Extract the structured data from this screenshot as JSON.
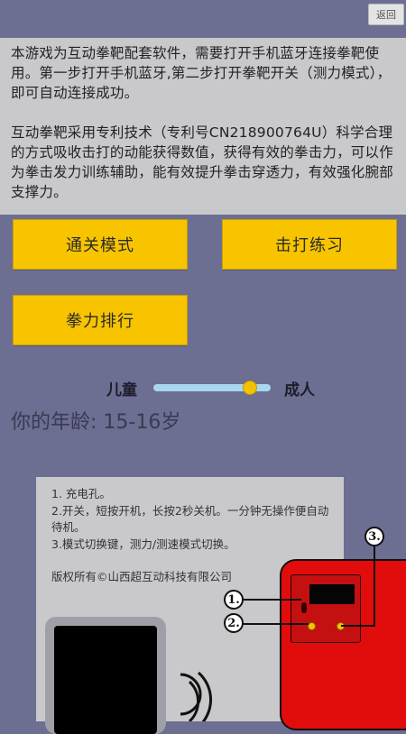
{
  "header": {
    "back_label": "返回"
  },
  "intro": {
    "paragraph1": "本游戏为互动拳靶配套软件，需要打开手机蓝牙连接拳靶使用。第一步打开手机蓝牙,第二步打开拳靶开关（测力模式），即可自动连接成功。",
    "paragraph2": "互动拳靶采用专利技术（专利号CN218900764U）科学合理的方式吸收击打的动能获得数值，获得有效的拳击力，可以作为拳击发力训练辅助，能有效提升拳击穿透力，有效强化腕部支撑力。"
  },
  "buttons": {
    "level_mode": "通关模式",
    "practice": "击打练习",
    "ranking": "拳力排行"
  },
  "age_slider": {
    "min_label": "儿童",
    "max_label": "成人",
    "value_fraction": 0.82,
    "age_label": "你的年龄: 15-16岁",
    "thumb_color": "#f2c200",
    "fill_color": "#a8d7ef"
  },
  "instructions": {
    "line1": "1. 充电孔。",
    "line2": "2.开关，短按开机，长按2秒关机。一分钟无操作便自动待机。",
    "line3": "3.模式切换键，测力/测速模式切换。",
    "copyright": "版权所有©山西超互动科技有限公司"
  },
  "callouts": [
    "1.",
    "2.",
    "3."
  ],
  "colors": {
    "background": "#6c6e92",
    "button_yellow": "#f8c400",
    "device_red": "#e10d0d"
  }
}
